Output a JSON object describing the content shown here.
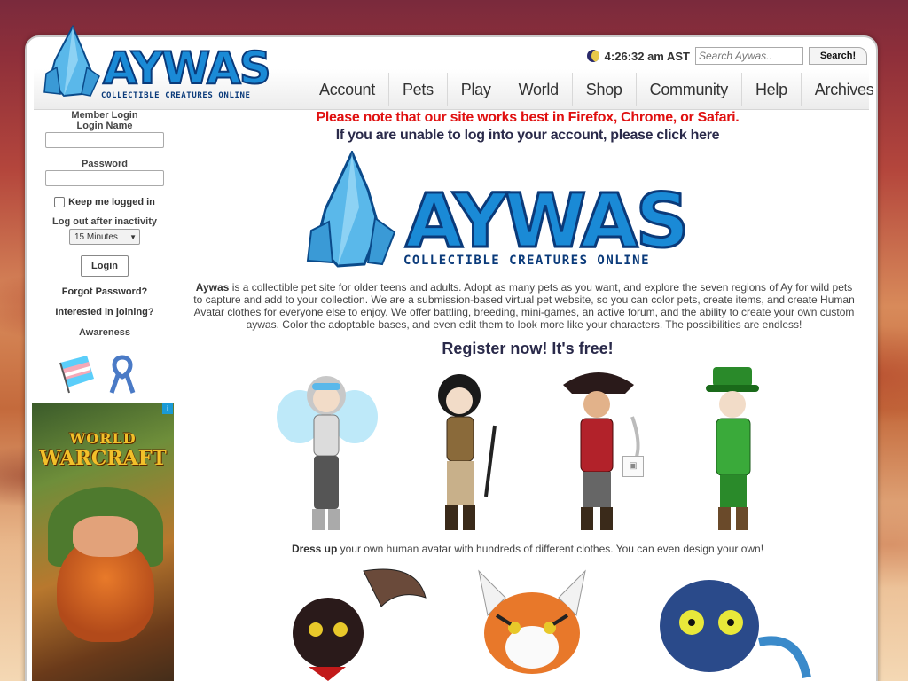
{
  "header": {
    "logo_title": "AYWAS",
    "logo_subtitle": "COLLECTIBLE CREATURES ONLINE",
    "time": "4:26:32 am AST",
    "search_placeholder": "Search Aywas..",
    "search_button": "Search!"
  },
  "nav": {
    "items": [
      "Account",
      "Pets",
      "Play",
      "World",
      "Shop",
      "Community",
      "Help",
      "Archives"
    ]
  },
  "sidebar": {
    "member_login": "Member Login",
    "login_name": "Login Name",
    "password": "Password",
    "keep_logged_in": "Keep me logged in",
    "logout_after": "Log out after inactivity",
    "inactivity_value": "15 Minutes",
    "login_button": "Login",
    "forgot_password": "Forgot Password?",
    "interested": "Interested in joining?",
    "awareness": "Awareness"
  },
  "ad": {
    "line1": "WORLD",
    "line2": "WARCRAFT",
    "badge": "i"
  },
  "main": {
    "notice_browser": "Please note that our site works best in Firefox, Chrome, or Safari.",
    "notice_login": "If you are unable to log into your account, please click here",
    "logo_title": "AYWAS",
    "logo_subtitle": "COLLECTIBLE CREATURES ONLINE",
    "intro_bold": "Aywas",
    "intro_text": " is a collectible pet site for older teens and adults. Adopt as many pets as you want, and explore the seven regions of Ay for wild pets to capture and add to your collection. We are a submission-based virtual pet website, so you can color pets, create items, and create Human Avatar clothes for everyone else to enjoy. We offer battling, breeding, mini-games, an active forum, and the ability to create your own custom aywas. Color the adoptable bases, and even edit them to look more like your characters. The possibilities are endless!",
    "register": "Register now! It's free!",
    "caption_bold": "Dress up",
    "caption_text": " your own human avatar with hundreds of different clothes. You can even design your own!"
  },
  "colors": {
    "notice_red": "#e01010",
    "logo_blue": "#1a8ad6",
    "logo_dark": "#0a3a7a"
  }
}
